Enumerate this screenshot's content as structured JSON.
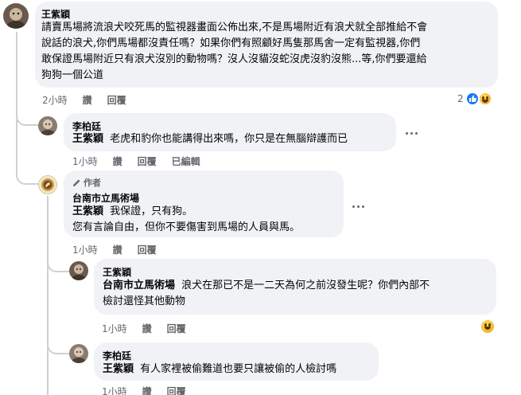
{
  "comments": [
    {
      "author": "王紫穎",
      "lines": [
        "請賣馬場將流浪犬咬死馬的監視器畫面公佈出來,不是馬場附近有浪犬就全部推給不會",
        "說話的浪犬,你們馬場都沒責任嗎？如果你們有照顧好馬隻那馬舍一定有監視器,你們",
        "敢保證馬場附近只有浪犬沒別的動物嗎？沒人沒貓沒蛇沒虎沒豹沒熊...等,你們要還給",
        "狗狗一個公道"
      ],
      "time": "2小時",
      "like": "讚",
      "reply": "回覆",
      "reaction_count": "2"
    },
    {
      "author": "李柏廷",
      "mention": "王紫穎",
      "text": "老虎和豹你也能講得出來嗎，你只是在無腦辯護而已",
      "time": "1小時",
      "like": "讚",
      "reply": "回覆",
      "edited": "已編輯"
    },
    {
      "badge": "作者",
      "author": "台南市立馬術場",
      "mention": "王紫穎",
      "line1": "我保證，只有狗。",
      "line2": "您有言論自由，但你不要傷害到馬場的人員與馬。",
      "time": "1小時",
      "like": "讚",
      "reply": "回覆"
    },
    {
      "author": "王紫穎",
      "mention": "台南市立馬術場",
      "line1": "浪犬在那已不是一二天為何之前沒發生呢？你們內部不",
      "line2": "檢討還怪其他動物",
      "time": "1小時",
      "like": "讚",
      "reply": "回覆"
    },
    {
      "author": "李柏廷",
      "mention": "王紫穎",
      "text": "有人家裡被偷難道也要只讓被偷的人檢討嗎",
      "time": "1小時",
      "like": "讚",
      "reply": "回覆"
    }
  ]
}
